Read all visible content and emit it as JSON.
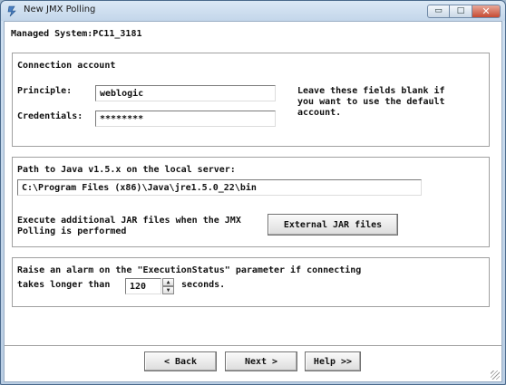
{
  "window": {
    "title": "New JMX Polling",
    "minimize_glyph": "▭",
    "maximize_glyph": "□",
    "close_glyph": "✕"
  },
  "header": {
    "managed_system": "Managed System:PC11_3181"
  },
  "connection": {
    "heading": "Connection account",
    "principle_label": "Principle:",
    "principle_value": "weblogic",
    "credentials_label": "Credentials:",
    "credentials_value": "********",
    "help_line1": "Leave these fields blank if",
    "help_line2": "you want to use the default",
    "help_line3": "account."
  },
  "java": {
    "path_label": "Path to Java v1.5.x on the local server:",
    "path_value": "C:\\Program Files (x86)\\Java\\jre1.5.0_22\\bin",
    "jar_line1": "Execute additional JAR files when the JMX",
    "jar_line2": "Polling is performed",
    "jar_button": "External JAR files"
  },
  "alarm": {
    "line1": "Raise an alarm on the \"ExecutionStatus\" parameter if connecting",
    "line2_prefix": "takes longer than",
    "timeout_value": "120",
    "line2_suffix": "seconds.",
    "spin_up": "▲",
    "spin_down": "▼"
  },
  "nav": {
    "back": "< Back",
    "next": "Next >",
    "help": "Help >>"
  },
  "icons": {
    "app": "jmx-app-icon"
  },
  "colors": {
    "close_button": "#c64a32",
    "title_bar": "#c3d6ea"
  }
}
